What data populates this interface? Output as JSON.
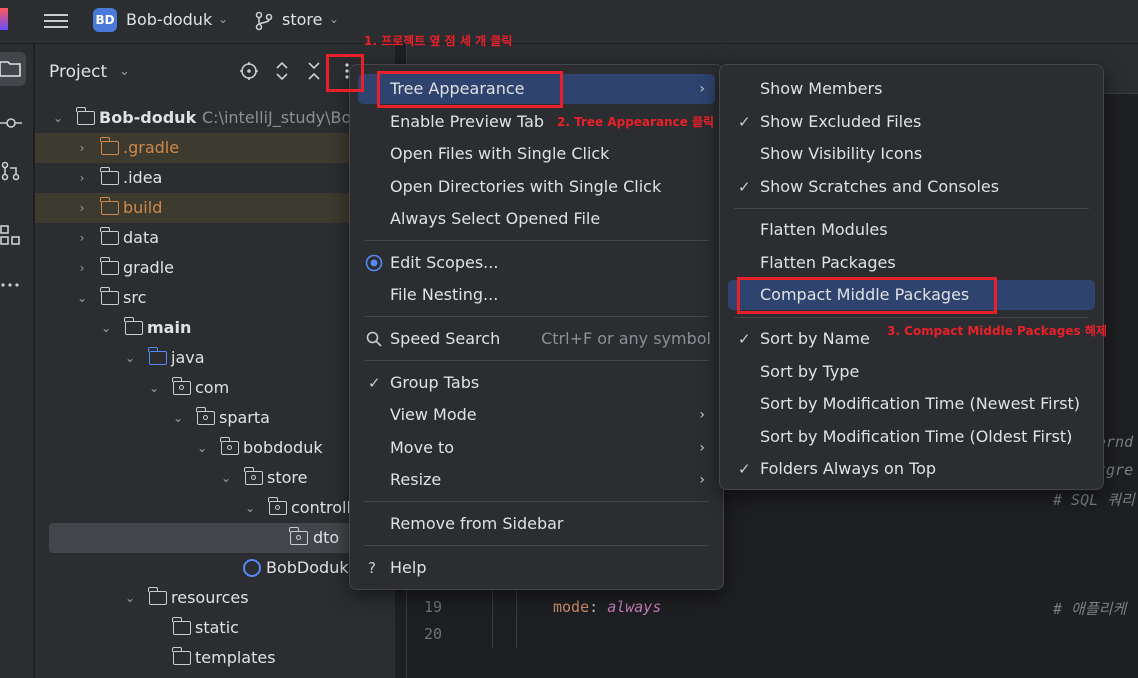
{
  "titlebar": {
    "project_badge": "BD",
    "project_name": "Bob-doduk",
    "branch": "store"
  },
  "panel": {
    "title": "Project",
    "tree": [
      {
        "label": "Bob-doduk",
        "path": "C:\\intelliJ_study\\Bo"
      },
      {
        "label": ".gradle"
      },
      {
        "label": ".idea"
      },
      {
        "label": "build"
      },
      {
        "label": "data"
      },
      {
        "label": "gradle"
      },
      {
        "label": "src"
      },
      {
        "label": "main"
      },
      {
        "label": "java"
      },
      {
        "label": "com"
      },
      {
        "label": "sparta"
      },
      {
        "label": "bobdoduk"
      },
      {
        "label": "store"
      },
      {
        "label": "controll"
      },
      {
        "label": "dto"
      },
      {
        "label": "BobDoduk"
      },
      {
        "label": "resources"
      },
      {
        "label": "static"
      },
      {
        "label": "templates"
      }
    ]
  },
  "editor": {
    "line19_no": "19",
    "line20_no": "20",
    "line19_key": "mode",
    "line19_colon": ":",
    "line19_value": "always",
    "line19_comment": "# 애플리케",
    "comment_sql": "# SQL 쿼리",
    "frag_1": "ernd",
    "frag_2": "tgre"
  },
  "menu_main": {
    "items": [
      {
        "label": "Tree Appearance",
        "submenu": true
      },
      {
        "label": "Enable Preview Tab"
      },
      {
        "label": "Open Files with Single Click"
      },
      {
        "label": "Open Directories with Single Click"
      },
      {
        "label": "Always Select Opened File"
      },
      {
        "label": "Edit Scopes..."
      },
      {
        "label": "File Nesting..."
      },
      {
        "label": "Speed Search",
        "shortcut": "Ctrl+F or any symbol"
      },
      {
        "label": "Group Tabs",
        "checked": true
      },
      {
        "label": "View Mode",
        "submenu": true
      },
      {
        "label": "Move to",
        "submenu": true
      },
      {
        "label": "Resize",
        "submenu": true
      },
      {
        "label": "Remove from Sidebar"
      },
      {
        "label": "Help"
      }
    ]
  },
  "menu_sub": {
    "items": [
      {
        "label": "Show Members"
      },
      {
        "label": "Show Excluded Files",
        "checked": true
      },
      {
        "label": "Show Visibility Icons"
      },
      {
        "label": "Show Scratches and Consoles",
        "checked": true
      },
      {
        "label": "Flatten Modules"
      },
      {
        "label": "Flatten Packages"
      },
      {
        "label": "Compact Middle Packages"
      },
      {
        "label": "Sort by Name",
        "checked": true
      },
      {
        "label": "Sort by Type"
      },
      {
        "label": "Sort by Modification Time (Newest First)"
      },
      {
        "label": "Sort by Modification Time (Oldest First)"
      },
      {
        "label": "Folders Always on Top",
        "checked": true
      }
    ]
  },
  "annotations": {
    "step1": "1. 프로젝트 옆 점 세 개 클릭",
    "step2": "2. Tree Appearance 클릭",
    "step3": "3. Compact Middle Packages 해제"
  },
  "colors": {
    "accent": "#2e436e",
    "annotation": "#e8202a",
    "excluded_folder": "#d0884a",
    "source_folder": "#548af7"
  }
}
